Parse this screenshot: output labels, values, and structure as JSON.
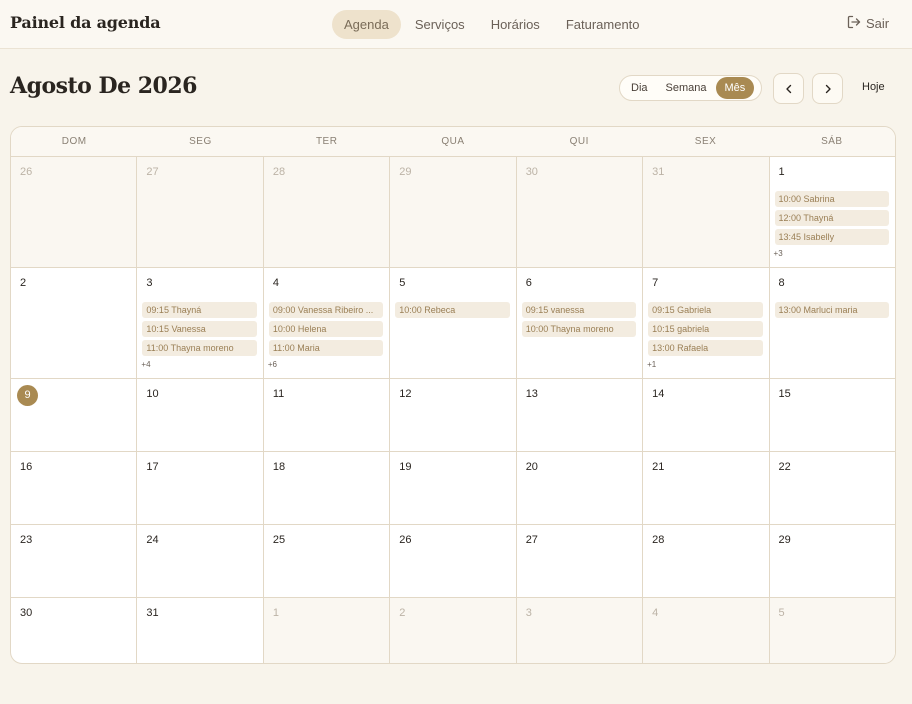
{
  "header": {
    "brand": "Painel da agenda",
    "nav": [
      {
        "label": "Agenda",
        "active": true
      },
      {
        "label": "Serviços",
        "active": false
      },
      {
        "label": "Horários",
        "active": false
      },
      {
        "label": "Faturamento",
        "active": false
      }
    ],
    "logout_label": "Sair",
    "logout_icon": "logout-icon"
  },
  "toolbar": {
    "title": "Agosto De 2026",
    "views": [
      {
        "label": "Dia",
        "active": false
      },
      {
        "label": "Semana",
        "active": false
      },
      {
        "label": "Mês",
        "active": true
      }
    ],
    "prev_icon": "chevron-left-icon",
    "next_icon": "chevron-right-icon",
    "today_label": "Hoje"
  },
  "colors": {
    "accent": "#a98a52",
    "event_bg": "#f3ece0",
    "event_text": "#9a7f55",
    "background": "#f8f4eb"
  },
  "calendar": {
    "weekdays": [
      "DOM",
      "SEG",
      "TER",
      "QUA",
      "QUI",
      "SEX",
      "SÁB"
    ],
    "weeks": [
      [
        {
          "day": "26",
          "outside": true,
          "events": []
        },
        {
          "day": "27",
          "outside": true,
          "events": []
        },
        {
          "day": "28",
          "outside": true,
          "events": []
        },
        {
          "day": "29",
          "outside": true,
          "events": []
        },
        {
          "day": "30",
          "outside": true,
          "events": []
        },
        {
          "day": "31",
          "outside": true,
          "events": []
        },
        {
          "day": "1",
          "outside": false,
          "events": [
            "10:00 Sabrina",
            "12:00 Thayná",
            "13:45 Isabelly"
          ],
          "more": "+3"
        }
      ],
      [
        {
          "day": "2",
          "outside": false,
          "events": []
        },
        {
          "day": "3",
          "outside": false,
          "events": [
            "09:15 Thayná",
            "10:15 Vanessa",
            "11:00 Thayna moreno"
          ],
          "more": "+4"
        },
        {
          "day": "4",
          "outside": false,
          "events": [
            "09:00 Vanessa Ribeiro ...",
            "10:00 Helena",
            "11:00 Maria"
          ],
          "more": "+6"
        },
        {
          "day": "5",
          "outside": false,
          "events": [
            "10:00 Rebeca"
          ]
        },
        {
          "day": "6",
          "outside": false,
          "events": [
            "09:15 vanessa",
            "10:00 Thayna moreno"
          ]
        },
        {
          "day": "7",
          "outside": false,
          "events": [
            "09:15 Gabriela",
            "10:15 gabriela",
            "13:00 Rafaela"
          ],
          "more": "+1"
        },
        {
          "day": "8",
          "outside": false,
          "events": [
            "13:00 Marluci maria"
          ]
        }
      ],
      [
        {
          "day": "9",
          "outside": false,
          "today": true,
          "events": []
        },
        {
          "day": "10",
          "outside": false,
          "events": []
        },
        {
          "day": "11",
          "outside": false,
          "events": []
        },
        {
          "day": "12",
          "outside": false,
          "events": []
        },
        {
          "day": "13",
          "outside": false,
          "events": []
        },
        {
          "day": "14",
          "outside": false,
          "events": []
        },
        {
          "day": "15",
          "outside": false,
          "events": []
        }
      ],
      [
        {
          "day": "16",
          "outside": false,
          "events": []
        },
        {
          "day": "17",
          "outside": false,
          "events": []
        },
        {
          "day": "18",
          "outside": false,
          "events": []
        },
        {
          "day": "19",
          "outside": false,
          "events": []
        },
        {
          "day": "20",
          "outside": false,
          "events": []
        },
        {
          "day": "21",
          "outside": false,
          "events": []
        },
        {
          "day": "22",
          "outside": false,
          "events": []
        }
      ],
      [
        {
          "day": "23",
          "outside": false,
          "events": []
        },
        {
          "day": "24",
          "outside": false,
          "events": []
        },
        {
          "day": "25",
          "outside": false,
          "events": []
        },
        {
          "day": "26",
          "outside": false,
          "events": []
        },
        {
          "day": "27",
          "outside": false,
          "events": []
        },
        {
          "day": "28",
          "outside": false,
          "events": []
        },
        {
          "day": "29",
          "outside": false,
          "events": []
        }
      ],
      [
        {
          "day": "30",
          "outside": false,
          "events": []
        },
        {
          "day": "31",
          "outside": false,
          "events": []
        },
        {
          "day": "1",
          "outside": true,
          "events": []
        },
        {
          "day": "2",
          "outside": true,
          "events": []
        },
        {
          "day": "3",
          "outside": true,
          "events": []
        },
        {
          "day": "4",
          "outside": true,
          "events": []
        },
        {
          "day": "5",
          "outside": true,
          "events": []
        }
      ]
    ]
  }
}
